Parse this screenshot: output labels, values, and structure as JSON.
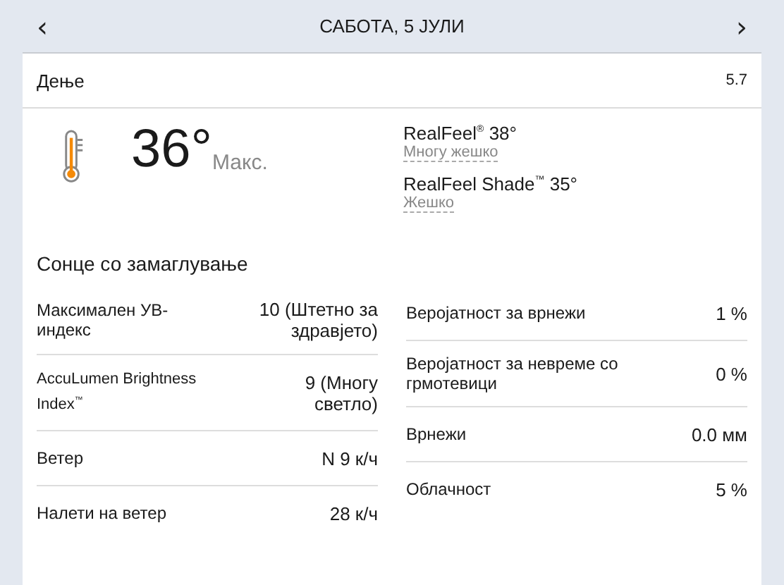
{
  "header": {
    "prev": "‹",
    "title": "САБОТА, 5 ЈУЛИ",
    "next": "›"
  },
  "period": {
    "label": "Дење",
    "value": "5.7"
  },
  "temperature": {
    "value": "36°",
    "label": "Макс."
  },
  "realfeel": [
    {
      "label": "RealFeel$^{®}$ 38°",
      "description": "Многу жешко"
    },
    {
      "label": "RealFeel Shade$^{™}$ 35°",
      "description": "Жешко"
    }
  ],
  "condition": "Сонце со замаглување",
  "details_left": [
    {
      "name": "Максимален УВ-индекс",
      "value": "10 (Штетно за здравјето)",
      "kind": "normal"
    },
    {
      "name": "AccuLumen Brightness Index$^{™}$",
      "value": "9 (Многу светло)",
      "kind": "small"
    },
    {
      "name": "Ветер",
      "value": "N 9 к/ч",
      "kind": "normal"
    },
    {
      "name": "Налети на ветер",
      "value": "28 к/ч",
      "kind": "normal"
    }
  ],
  "details_right": [
    {
      "name": "Веројатност за врнежи",
      "value": "1 %"
    },
    {
      "name": "Веројатност за невреме со грмотевици",
      "value": "0 %"
    },
    {
      "name": "Врнежи",
      "value": "0.0 мм"
    },
    {
      "name": "Облачност",
      "value": "5 %"
    }
  ]
}
